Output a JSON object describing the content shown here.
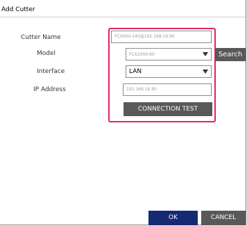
{
  "window": {
    "title": "Add Cutter"
  },
  "form": {
    "cutter_name_label": "Cutter Name",
    "cutter_name_value": "FCX000-140@192.168.16.90",
    "model_label": "Model",
    "model_value": "FCX2000-60",
    "search_label": "Search",
    "interface_label": "Interface",
    "interface_value": "LAN",
    "ip_label": "IP Address",
    "ip_value": "192.168.16.90",
    "connection_test_label": "CONNECTION TEST"
  },
  "footer": {
    "ok_label": "OK",
    "cancel_label": "CANCEL"
  },
  "colors": {
    "highlight": "#e0206a",
    "primary_button": "#152a73",
    "secondary_button": "#595959"
  }
}
